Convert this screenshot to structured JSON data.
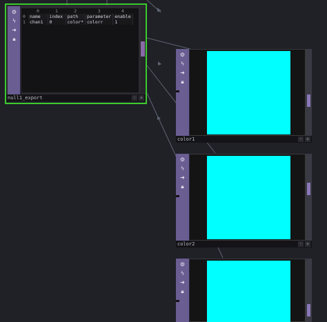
{
  "nodes": {
    "null1_export": {
      "label": "null1_export",
      "columns": [
        "0",
        "1",
        "2",
        "3",
        "4"
      ],
      "rows": [
        {
          "index": "0",
          "cells": [
            "name",
            "index",
            "path",
            "parameter",
            "enable"
          ]
        },
        {
          "index": "1",
          "cells": [
            "chan1",
            "0",
            "color*",
            "colorr",
            "1"
          ]
        }
      ]
    },
    "color1": {
      "label": "color1"
    },
    "color2": {
      "label": "color2"
    },
    "color3": {
      "label": ""
    }
  },
  "sidebar_icons": [
    "settings-icon",
    "bypass-icon",
    "arrow-icon",
    "lock-icon"
  ],
  "colors": {
    "preview": "#00ffff",
    "selection_border": "#3ecb2e",
    "node_sidebar": "#6a5d92",
    "background": "#1f2127"
  }
}
